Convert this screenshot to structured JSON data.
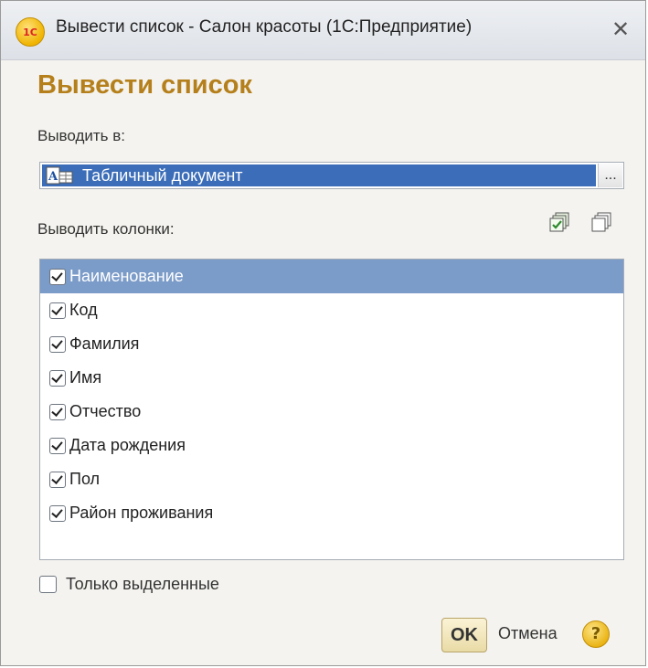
{
  "window": {
    "title": "Вывести список - Салон красоты  (1С:Предприятие)",
    "logo_text": "1С",
    "close_glyph": "✕"
  },
  "form": {
    "title": "Вывести список",
    "output_label": "Выводить в:",
    "output_value": "Табличный документ",
    "output_icon": "spreadsheet-document-icon",
    "ellipsis_label": "...",
    "columns_label": "Выводить колонки:",
    "columns": [
      {
        "label": "Наименование",
        "checked": true,
        "selected": true
      },
      {
        "label": "Код",
        "checked": true,
        "selected": false
      },
      {
        "label": "Фамилия",
        "checked": true,
        "selected": false
      },
      {
        "label": "Имя",
        "checked": true,
        "selected": false
      },
      {
        "label": "Отчество",
        "checked": true,
        "selected": false
      },
      {
        "label": "Дата рождения",
        "checked": true,
        "selected": false
      },
      {
        "label": "Пол",
        "checked": true,
        "selected": false
      },
      {
        "label": "Район проживания",
        "checked": true,
        "selected": false
      }
    ],
    "only_selected_label": "Только выделенные",
    "only_selected_checked": false
  },
  "buttons": {
    "ok": "OK",
    "cancel": "Отмена",
    "help": "?"
  },
  "colors": {
    "title_accent": "#b5801c",
    "selection": "#3b6db8",
    "list_selection": "#7b9bc8"
  }
}
